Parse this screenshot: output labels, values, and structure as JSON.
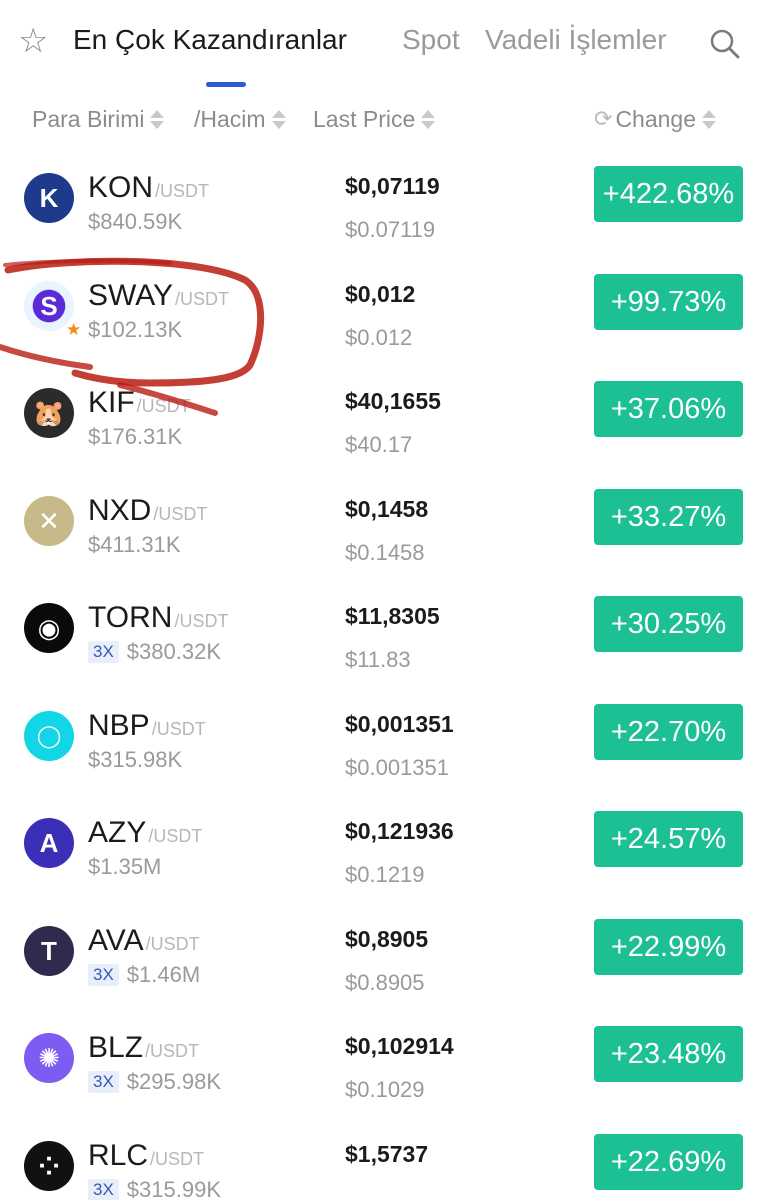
{
  "tabs": {
    "active": "En Çok Kazandıranlar",
    "spot": "Spot",
    "futures": "Vadeli İşlemler"
  },
  "columns": {
    "pair": "Para Birimi",
    "volume": "/Hacim",
    "last_price": "Last Price",
    "change": "Change"
  },
  "colors": {
    "positive": "#1dbf95",
    "accent": "#2a5bd7",
    "annotation": "#b81d12"
  },
  "rows": [
    {
      "symbol": "KON",
      "quote": "/USDT",
      "volume": "$840.59K",
      "leverage": "",
      "price": "$0,07119",
      "price_sub": "$0.07119",
      "change": "+422.68%",
      "logo": "kon-logo-icon",
      "logo_color": "#1e3a8a",
      "logo_glyph": "K",
      "favorite": false
    },
    {
      "symbol": "SWAY",
      "quote": "/USDT",
      "volume": "$102.13K",
      "leverage": "",
      "price": "$0,012",
      "price_sub": "$0.012",
      "change": "+99.73%",
      "logo": "sway-logo-icon",
      "logo_color": "#5b2bd6",
      "logo_glyph": "S",
      "favorite": true
    },
    {
      "symbol": "KIF",
      "quote": "/USDT",
      "volume": "$176.31K",
      "leverage": "",
      "price": "$40,1655",
      "price_sub": "$40.17",
      "change": "+37.06%",
      "logo": "kif-logo-icon",
      "logo_color": "#2b2b2b",
      "logo_glyph": "🐹",
      "favorite": false
    },
    {
      "symbol": "NXD",
      "quote": "/USDT",
      "volume": "$411.31K",
      "leverage": "",
      "price": "$0,1458",
      "price_sub": "$0.1458",
      "change": "+33.27%",
      "logo": "nxd-logo-icon",
      "logo_color": "#c8b98a",
      "logo_glyph": "✕",
      "favorite": false
    },
    {
      "symbol": "TORN",
      "quote": "/USDT",
      "volume": "$380.32K",
      "leverage": "3X",
      "price": "$11,8305",
      "price_sub": "$11.83",
      "change": "+30.25%",
      "logo": "torn-logo-icon",
      "logo_color": "#0a0a0a",
      "logo_glyph": "◉",
      "favorite": false
    },
    {
      "symbol": "NBP",
      "quote": "/USDT",
      "volume": "$315.98K",
      "leverage": "",
      "price": "$0,001351",
      "price_sub": "$0.001351",
      "change": "+22.70%",
      "logo": "nbp-logo-icon",
      "logo_color": "#12d6e6",
      "logo_glyph": "◯",
      "favorite": false
    },
    {
      "symbol": "AZY",
      "quote": "/USDT",
      "volume": "$1.35M",
      "leverage": "",
      "price": "$0,121936",
      "price_sub": "$0.1219",
      "change": "+24.57%",
      "logo": "azy-logo-icon",
      "logo_color": "#3b2fb8",
      "logo_glyph": "A",
      "favorite": false
    },
    {
      "symbol": "AVA",
      "quote": "/USDT",
      "volume": "$1.46M",
      "leverage": "3X",
      "price": "$0,8905",
      "price_sub": "$0.8905",
      "change": "+22.99%",
      "logo": "ava-logo-icon",
      "logo_color": "#2e2b4f",
      "logo_glyph": "T",
      "favorite": false
    },
    {
      "symbol": "BLZ",
      "quote": "/USDT",
      "volume": "$295.98K",
      "leverage": "3X",
      "price": "$0,102914",
      "price_sub": "$0.1029",
      "change": "+23.48%",
      "logo": "blz-logo-icon",
      "logo_color": "#7d5cf2",
      "logo_glyph": "✺",
      "favorite": false
    },
    {
      "symbol": "RLC",
      "quote": "/USDT",
      "volume": "$315.99K",
      "leverage": "3X",
      "price": "$1,5737",
      "price_sub": "",
      "change": "+22.69%",
      "logo": "rlc-logo-icon",
      "logo_color": "#111111",
      "logo_glyph": "⁘",
      "favorite": false
    }
  ]
}
